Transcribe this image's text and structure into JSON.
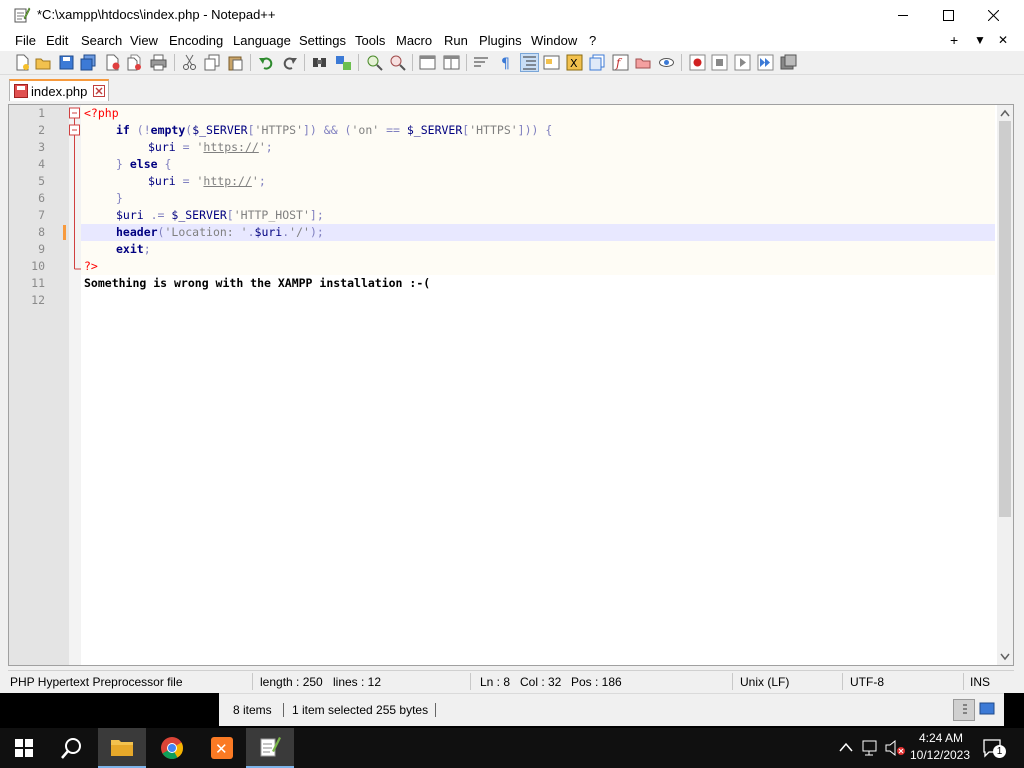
{
  "window": {
    "title": "*C:\\xampp\\htdocs\\index.php - Notepad++"
  },
  "menu": {
    "items": [
      "File",
      "Edit",
      "Search",
      "View",
      "Encoding",
      "Language",
      "Settings",
      "Tools",
      "Macro",
      "Run",
      "Plugins",
      "Window",
      "?"
    ],
    "right": [
      "+",
      "▼",
      "✕"
    ]
  },
  "tab": {
    "label": "index.php"
  },
  "editor": {
    "line_numbers": [
      "1",
      "2",
      "3",
      "4",
      "5",
      "6",
      "7",
      "8",
      "9",
      "10",
      "11",
      "12"
    ],
    "current_line": 8
  },
  "code": {
    "l1": "<?php",
    "l2_if": "if",
    "l2_a": " (!",
    "l2_empty": "empty",
    "l2_b": "(",
    "l2_var": "$_SERVER",
    "l2_c": "[",
    "l2_s1": "'HTTPS'",
    "l2_d": "]) && (",
    "l2_s2": "'on'",
    "l2_e": " == ",
    "l2_var2": "$_SERVER",
    "l2_f": "[",
    "l2_s3": "'HTTPS'",
    "l2_g": "])) {",
    "l3_var": "$uri",
    "l3_a": " = ",
    "l3_q1": "'",
    "l3_url": "https://",
    "l3_q2": "'",
    "l3_b": ";",
    "l4_a": "} ",
    "l4_else": "else",
    "l4_b": " {",
    "l5_var": "$uri",
    "l5_a": " = ",
    "l5_q1": "'",
    "l5_url": "http://",
    "l5_q2": "'",
    "l5_b": ";",
    "l6": "}",
    "l7_var": "$uri",
    "l7_a": " .= ",
    "l7_var2": "$_SERVER",
    "l7_b": "[",
    "l7_s": "'HTTP_HOST'",
    "l7_c": "];",
    "l8_fn": "header",
    "l8_a": "(",
    "l8_s1": "'Location: '",
    "l8_b": ".",
    "l8_var": "$uri",
    "l8_c": ".",
    "l8_s2": "'/'",
    "l8_d": ");",
    "l9_kw": "exit",
    "l9_a": ";",
    "l10": "?>",
    "l11": "Something is wrong with the XAMPP installation :-("
  },
  "status": {
    "file_type": "PHP Hypertext Preprocessor file",
    "length": "length : 250",
    "lines": "lines : 12",
    "ln": "Ln : 8",
    "col": "Col : 32",
    "pos": "Pos : 186",
    "eol": "Unix (LF)",
    "encoding": "UTF-8",
    "mode": "INS"
  },
  "explorer": {
    "items": "8 items",
    "selected": "1 item selected  255 bytes"
  },
  "taskbar": {
    "time": "4:24 AM",
    "date": "10/12/2023",
    "notifications": "1"
  },
  "colors": {
    "accent_tab": "#f79a3d",
    "current_line": "#e8e8ff",
    "php_tag": "#ff0000",
    "keyword": "#000080"
  }
}
